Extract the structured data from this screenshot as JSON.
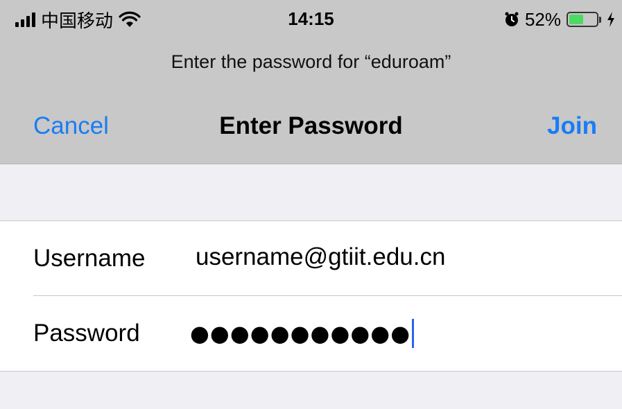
{
  "status_bar": {
    "carrier": "中国移动",
    "time": "14:15",
    "battery_percent": "52%",
    "battery_level": 0.52,
    "icons": [
      "signal-icon",
      "wifi-icon",
      "alarm-icon",
      "battery-icon",
      "charging-icon"
    ]
  },
  "prompt": "Enter the password for “eduroam”",
  "nav": {
    "cancel_label": "Cancel",
    "title": "Enter Password",
    "join_label": "Join"
  },
  "form": {
    "username_label": "Username",
    "username_value": "username@gtiit.edu.cn",
    "password_label": "Password",
    "password_value": "●●●●●●●●●●●"
  },
  "colors": {
    "accent": "#1a7cf6",
    "header_bg": "#c8c8c8",
    "battery_fill": "#4cd964",
    "page_bg": "#efeff4"
  }
}
